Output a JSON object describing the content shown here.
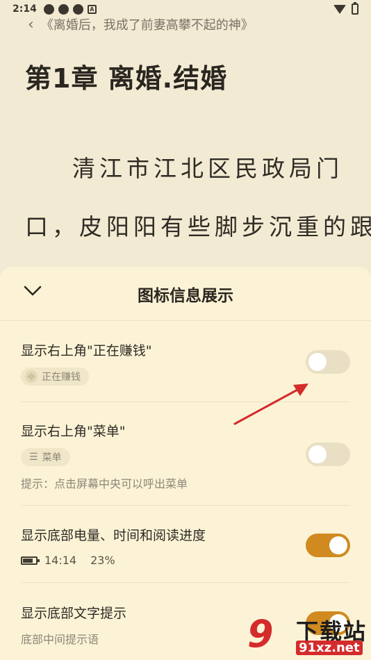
{
  "status_bar": {
    "time": "2:14",
    "badge": "A"
  },
  "reader": {
    "book_title": "《离婚后，我成了前妻高攀不起的神》",
    "chapter_title": "第1章 离婚.结婚",
    "paragraph_lines": [
      "清江市江北区民政局门",
      "口，皮阳阳有些脚步沉重的跟",
      " "
    ]
  },
  "sheet": {
    "title": "图标信息展示",
    "settings": [
      {
        "label": "显示右上角\"正在赚钱\"",
        "chip": "正在赚钱",
        "enabled": false
      },
      {
        "label": "显示右上角\"菜单\"",
        "chip": "菜单",
        "hint": "提示：点击屏幕中央可以呼出菜单",
        "enabled": false
      },
      {
        "label": "显示底部电量、时间和阅读进度",
        "time": "14:14",
        "progress": "23%",
        "enabled": true
      },
      {
        "label": "显示底部文字提示",
        "hint": "底部中间提示语",
        "enabled": true
      }
    ]
  },
  "watermark": {
    "number": "9",
    "top_text": "下载站",
    "bottom_text": "91xz.net"
  },
  "colors": {
    "accent": "#d08a1f",
    "sheet_bg": "#fcf3d6",
    "page_bg": "#f3ead3",
    "annotation": "#d42b2b"
  }
}
